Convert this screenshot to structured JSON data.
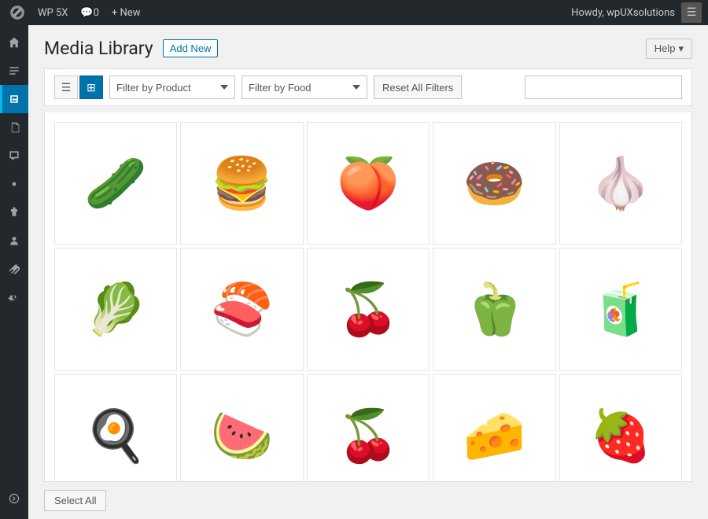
{
  "admin_bar": {
    "wp_logo": "🅦",
    "site_name": "WP 5X",
    "comments": "0",
    "new_label": "+ New",
    "user_greeting": "Howdy, wpUXsolutions"
  },
  "help_button": "Help",
  "page": {
    "title": "Media Library",
    "add_new_label": "Add New"
  },
  "toolbar": {
    "filter_product_label": "Filter by Product",
    "filter_food_label": "Filter by Food",
    "reset_label": "Reset All Filters",
    "search_placeholder": ""
  },
  "sidebar": {
    "items": [
      {
        "icon": "🏠",
        "name": "home",
        "label": "Dashboard"
      },
      {
        "icon": "✦",
        "name": "posts",
        "label": "Posts"
      },
      {
        "icon": "🖥",
        "name": "media",
        "label": "Media",
        "active": true
      },
      {
        "icon": "📄",
        "name": "pages",
        "label": "Pages"
      },
      {
        "icon": "💬",
        "name": "comments",
        "label": "Comments"
      },
      {
        "icon": "🎨",
        "name": "appearance",
        "label": "Appearance"
      },
      {
        "icon": "🔌",
        "name": "plugins",
        "label": "Plugins"
      },
      {
        "icon": "👤",
        "name": "users",
        "label": "Users"
      },
      {
        "icon": "🔧",
        "name": "tools",
        "label": "Tools"
      },
      {
        "icon": "⚙",
        "name": "settings",
        "label": "Settings"
      },
      {
        "icon": "▶",
        "name": "collapse",
        "label": "Collapse menu"
      }
    ]
  },
  "media_items": [
    {
      "emoji": "🥒",
      "alt": "Cucumber"
    },
    {
      "emoji": "🍔",
      "alt": "Burger"
    },
    {
      "emoji": "🍑",
      "alt": "Peach"
    },
    {
      "emoji": "🍩",
      "alt": "Donut"
    },
    {
      "emoji": "🧄",
      "alt": "Garlic"
    },
    {
      "emoji": "🥬",
      "alt": "Lettuce"
    },
    {
      "emoji": "🍣",
      "alt": "Sushi"
    },
    {
      "emoji": "🍒",
      "alt": "Cherries"
    },
    {
      "emoji": "🫑",
      "alt": "Green Pepper"
    },
    {
      "emoji": "🧃",
      "alt": "Orange Juice"
    },
    {
      "emoji": "🍳",
      "alt": "Egg"
    },
    {
      "emoji": "🍉",
      "alt": "Watermelon"
    },
    {
      "emoji": "🍒",
      "alt": "Cherry"
    },
    {
      "emoji": "🧀",
      "alt": "Cheese"
    },
    {
      "emoji": "🍓",
      "alt": "Strawberry"
    }
  ],
  "footer": {
    "select_all_label": "Select All"
  }
}
